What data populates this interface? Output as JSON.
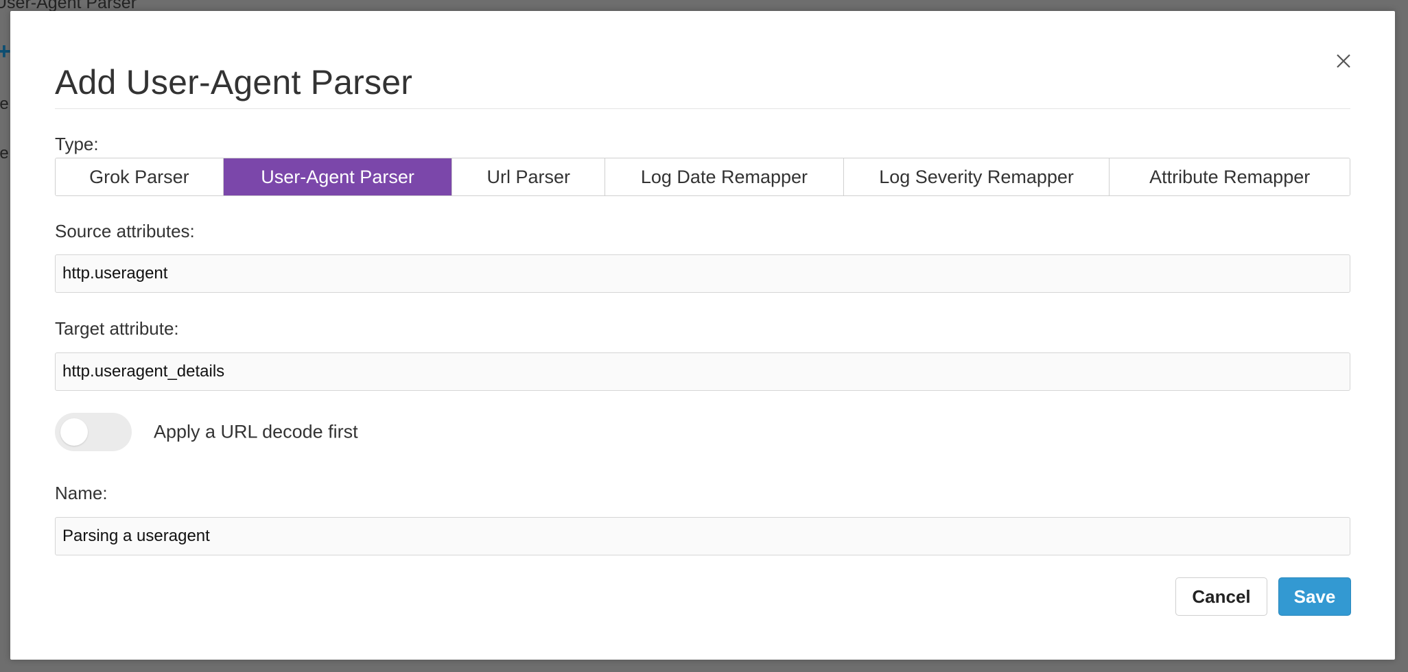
{
  "background": {
    "title": "User-Agent Parser",
    "row_fragments": [
      "pe",
      "pe"
    ]
  },
  "modal": {
    "title": "Add User-Agent Parser",
    "type_label": "Type:",
    "tabs": [
      {
        "label": "Grok Parser",
        "active": false
      },
      {
        "label": "User-Agent Parser",
        "active": true
      },
      {
        "label": "Url Parser",
        "active": false
      },
      {
        "label": "Log Date Remapper",
        "active": false
      },
      {
        "label": "Log Severity Remapper",
        "active": false
      },
      {
        "label": "Attribute Remapper",
        "active": false
      }
    ],
    "source_label": "Source attributes:",
    "source_value": "http.useragent",
    "target_label": "Target attribute:",
    "target_value": "http.useragent_details",
    "toggle": {
      "label": "Apply a URL decode first",
      "on": false
    },
    "name_label": "Name:",
    "name_value": "Parsing a useragent",
    "cancel_label": "Cancel",
    "save_label": "Save"
  },
  "colors": {
    "active_tab": "#7b47aa",
    "save_button": "#3399d2",
    "overlay": "#6b6b6b"
  }
}
